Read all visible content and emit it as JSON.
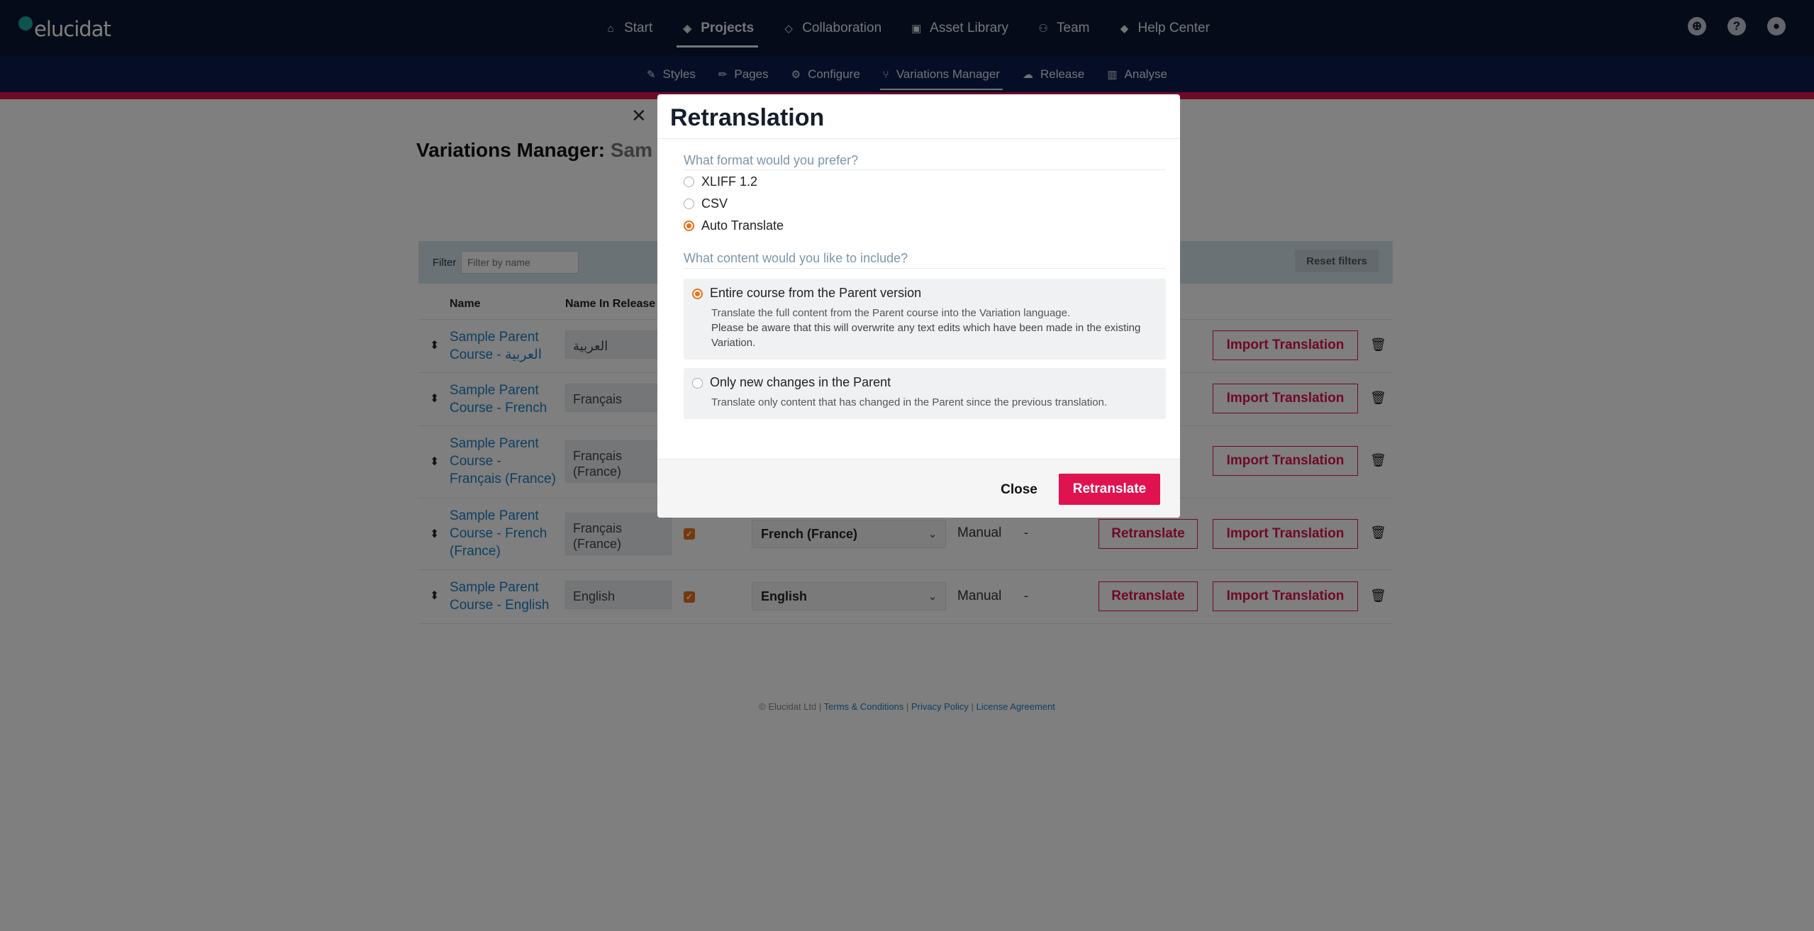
{
  "app": {
    "logo_text": "elucidat"
  },
  "main_nav": [
    {
      "label": "Start",
      "icon": "home-icon"
    },
    {
      "label": "Projects",
      "icon": "layers-icon",
      "active": true
    },
    {
      "label": "Collaboration",
      "icon": "diamond-icon"
    },
    {
      "label": "Asset Library",
      "icon": "images-icon"
    },
    {
      "label": "Team",
      "icon": "users-icon"
    },
    {
      "label": "Help Center",
      "icon": "graduation-cap-icon"
    }
  ],
  "sub_nav": [
    {
      "label": "Styles",
      "icon": "brush-icon"
    },
    {
      "label": "Pages",
      "icon": "pencil-icon"
    },
    {
      "label": "Configure",
      "icon": "gear-icon"
    },
    {
      "label": "Variations Manager",
      "icon": "branch-icon",
      "active": true
    },
    {
      "label": "Release",
      "icon": "cloud-upload-icon"
    },
    {
      "label": "Analyse",
      "icon": "bar-chart-icon"
    }
  ],
  "page": {
    "title": "Variations Manager:",
    "project_partial": "Sam",
    "filter_label": "Filter",
    "filter_placeholder": "Filter by name",
    "reset_label": "Reset filters",
    "columns": {
      "name": "Name",
      "name_in_release": "Name In Release"
    },
    "rows": [
      {
        "name": "Sample Parent Course - العربية",
        "release_name": "العربية",
        "language": "",
        "method": "",
        "last": ""
      },
      {
        "name": "Sample Parent Course - French",
        "release_name": "Français",
        "language": "",
        "method": "",
        "last": ""
      },
      {
        "name": "Sample Parent Course - Français (France)",
        "release_name": "Français (France)",
        "language": "",
        "method": "",
        "last": ""
      },
      {
        "name": "Sample Parent Course - French (France)",
        "release_name": "Français (France)",
        "language": "French (France)",
        "method": "Manual",
        "last": "-"
      },
      {
        "name": "Sample Parent Course - English",
        "release_name": "English",
        "language": "English",
        "method": "Manual",
        "last": "-"
      }
    ],
    "retranslate_label": "Retranslate",
    "import_label": "Import Translation"
  },
  "footer": {
    "copyright": "© Elucidat Ltd |",
    "terms": "Terms & Conditions",
    "sep1": "|",
    "privacy": "Privacy Policy",
    "sep2": "|",
    "license": "License Agreement"
  },
  "modal": {
    "title": "Retranslation",
    "format_question": "What format would you prefer?",
    "formats": [
      {
        "label": "XLIFF 1.2",
        "selected": false
      },
      {
        "label": "CSV",
        "selected": false
      },
      {
        "label": "Auto Translate",
        "selected": true
      }
    ],
    "content_question": "What content would you like to include?",
    "option_entire": {
      "title": "Entire course from the Parent version",
      "desc": "Translate the full content from the Parent course into the Variation language.",
      "warning": "Please be aware that this will overwrite any text edits which have been made in the existing Variation.",
      "selected": true
    },
    "option_new": {
      "title": "Only new changes in the Parent",
      "desc": "Translate only content that has changed in the Parent since the previous translation.",
      "selected": false
    },
    "close_label": "Close",
    "retranslate_label": "Retranslate"
  },
  "colors": {
    "brand_pink": "#e0124f",
    "nav_dark": "#0b1633",
    "accent_orange": "#e8731a",
    "link_blue": "#1a7fc4"
  }
}
